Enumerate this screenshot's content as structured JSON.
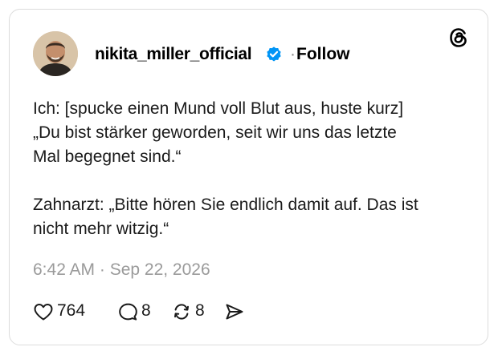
{
  "post": {
    "username": "nikita_miller_official",
    "follow_label": "Follow",
    "separator": "·",
    "text": "Ich: [spucke einen Mund voll Blut aus, huste kurz]\n„Du bist stärker geworden, seit wir uns das letzte\nMal begegnet sind.“\n\nZahnarzt: „Bitte hören Sie endlich damit auf. Das ist\nnicht mehr witzig.“",
    "timestamp": "6:42 AM · Sep 22, 2026",
    "likes": "764",
    "replies": "8",
    "reposts": "8"
  },
  "icons": {
    "platform": "threads-logo-icon",
    "verified": "verified-badge-icon",
    "like": "heart-icon",
    "reply": "comment-icon",
    "repost": "repost-icon",
    "share": "send-icon"
  },
  "colors": {
    "verified_blue": "#0095f6",
    "secondary_text": "#9a9a9a",
    "border": "#dcdcdc"
  }
}
